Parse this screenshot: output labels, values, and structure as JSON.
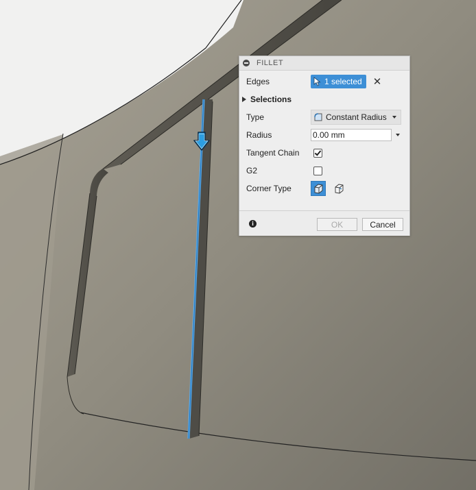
{
  "dialog": {
    "title": "FILLET",
    "edges_label": "Edges",
    "edges_value": "1 selected",
    "clear_symbol": "✕",
    "selections_label": "Selections",
    "type_label": "Type",
    "type_value": "Constant Radius",
    "radius_label": "Radius",
    "radius_value": "0.00 mm",
    "tangent_chain_label": "Tangent Chain",
    "tangent_chain_checked": true,
    "g2_label": "G2",
    "g2_checked": false,
    "corner_type_label": "Corner Type",
    "ok_label": "OK",
    "cancel_label": "Cancel",
    "info_symbol": "i"
  },
  "icons": {
    "collapse": "collapse-icon",
    "cursor": "cursor-arrow-icon",
    "clear": "close-icon",
    "type": "fillet-type-icon",
    "corner_rolling_ball": "corner-rolling-ball-icon",
    "corner_setback": "corner-setback-icon",
    "info": "info-icon",
    "manipulator": "drag-arrow-icon"
  },
  "colors": {
    "selection_blue": "#3d8fd6",
    "edge_highlight": "#5aaef0",
    "model_surface": "#8f8b80",
    "background": "#f2f2f2"
  }
}
